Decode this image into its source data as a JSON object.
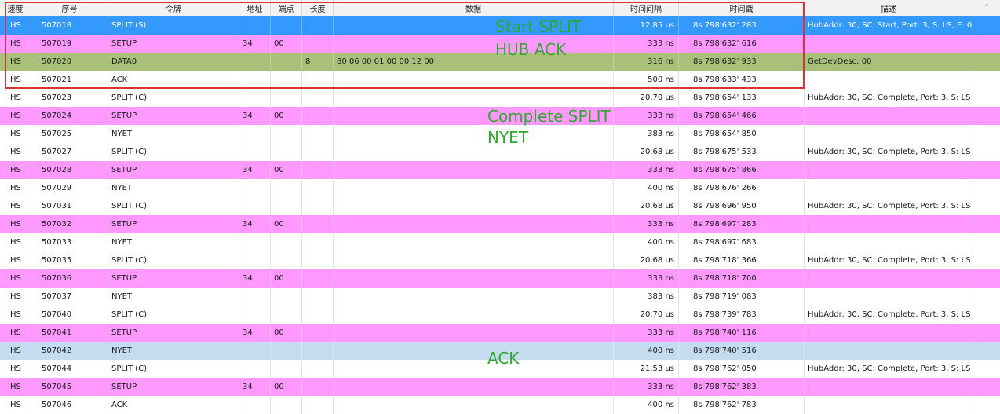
{
  "columns": {
    "speed": "速度",
    "seq": "序号",
    "token": "令牌",
    "addr": "地址",
    "endpoint": "端点",
    "length": "长度",
    "data": "数据",
    "interval": "时间间隔",
    "timestamp": "时间戳",
    "desc": "描述",
    "extra": "⌃"
  },
  "row_colors": {
    "setup": "#ff99ff",
    "selected": "#3399ff",
    "data0": "#a9c07a",
    "highlight": "#c5dcf0"
  },
  "rows": [
    {
      "style": "sel",
      "speed": "HS",
      "seq": "507018",
      "token": "SPLIT (S)",
      "addr": "",
      "endpoint": "",
      "length": "",
      "data": "",
      "interval": "12.85 us",
      "timestamp": "8s 798'632' 283",
      "desc": "HubAddr: 30, SC: Start, Port: 3, S: LS, E: 0"
    },
    {
      "style": "setup",
      "speed": "HS",
      "seq": "507019",
      "token": "SETUP",
      "addr": "34",
      "endpoint": "00",
      "length": "",
      "data": "",
      "interval": "333 ns",
      "timestamp": "8s 798'632' 616",
      "desc": ""
    },
    {
      "style": "data0",
      "speed": "HS",
      "seq": "507020",
      "token": "DATA0",
      "addr": "",
      "endpoint": "",
      "length": "8",
      "data": "80 06 00 01 00 00 12 00",
      "interval": "316 ns",
      "timestamp": "8s 798'632' 933",
      "desc": " GetDevDesc: 00"
    },
    {
      "style": "",
      "speed": "HS",
      "seq": "507021",
      "token": "ACK",
      "addr": "",
      "endpoint": "",
      "length": "",
      "data": "",
      "interval": "500 ns",
      "timestamp": "8s 798'633' 433",
      "desc": ""
    },
    {
      "style": "",
      "speed": "HS",
      "seq": "507023",
      "token": "SPLIT (C)",
      "addr": "",
      "endpoint": "",
      "length": "",
      "data": "",
      "interval": "20.70 us",
      "timestamp": "8s 798'654' 133",
      "desc": "HubAddr: 30, SC: Complete, Port: 3, S: LS"
    },
    {
      "style": "setup",
      "speed": "HS",
      "seq": "507024",
      "token": "SETUP",
      "addr": "34",
      "endpoint": "00",
      "length": "",
      "data": "",
      "interval": "333 ns",
      "timestamp": "8s 798'654' 466",
      "desc": ""
    },
    {
      "style": "",
      "speed": "HS",
      "seq": "507025",
      "token": "NYET",
      "addr": "",
      "endpoint": "",
      "length": "",
      "data": "",
      "interval": "383 ns",
      "timestamp": "8s 798'654' 850",
      "desc": ""
    },
    {
      "style": "",
      "speed": "HS",
      "seq": "507027",
      "token": "SPLIT (C)",
      "addr": "",
      "endpoint": "",
      "length": "",
      "data": "",
      "interval": "20.68 us",
      "timestamp": "8s 798'675' 533",
      "desc": "HubAddr: 30, SC: Complete, Port: 3, S: LS"
    },
    {
      "style": "setup",
      "speed": "HS",
      "seq": "507028",
      "token": "SETUP",
      "addr": "34",
      "endpoint": "00",
      "length": "",
      "data": "",
      "interval": "333 ns",
      "timestamp": "8s 798'675' 866",
      "desc": ""
    },
    {
      "style": "",
      "speed": "HS",
      "seq": "507029",
      "token": "NYET",
      "addr": "",
      "endpoint": "",
      "length": "",
      "data": "",
      "interval": "400 ns",
      "timestamp": "8s 798'676' 266",
      "desc": ""
    },
    {
      "style": "",
      "speed": "HS",
      "seq": "507031",
      "token": "SPLIT (C)",
      "addr": "",
      "endpoint": "",
      "length": "",
      "data": "",
      "interval": "20.68 us",
      "timestamp": "8s 798'696' 950",
      "desc": "HubAddr: 30, SC: Complete, Port: 3, S: LS"
    },
    {
      "style": "setup",
      "speed": "HS",
      "seq": "507032",
      "token": "SETUP",
      "addr": "34",
      "endpoint": "00",
      "length": "",
      "data": "",
      "interval": "333 ns",
      "timestamp": "8s 798'697' 283",
      "desc": ""
    },
    {
      "style": "",
      "speed": "HS",
      "seq": "507033",
      "token": "NYET",
      "addr": "",
      "endpoint": "",
      "length": "",
      "data": "",
      "interval": "400 ns",
      "timestamp": "8s 798'697' 683",
      "desc": ""
    },
    {
      "style": "",
      "speed": "HS",
      "seq": "507035",
      "token": "SPLIT (C)",
      "addr": "",
      "endpoint": "",
      "length": "",
      "data": "",
      "interval": "20.68 us",
      "timestamp": "8s 798'718' 366",
      "desc": "HubAddr: 30, SC: Complete, Port: 3, S: LS"
    },
    {
      "style": "setup",
      "speed": "HS",
      "seq": "507036",
      "token": "SETUP",
      "addr": "34",
      "endpoint": "00",
      "length": "",
      "data": "",
      "interval": "333 ns",
      "timestamp": "8s 798'718' 700",
      "desc": ""
    },
    {
      "style": "",
      "speed": "HS",
      "seq": "507037",
      "token": "NYET",
      "addr": "",
      "endpoint": "",
      "length": "",
      "data": "",
      "interval": "383 ns",
      "timestamp": "8s 798'719' 083",
      "desc": ""
    },
    {
      "style": "",
      "speed": "HS",
      "seq": "507040",
      "token": "SPLIT (C)",
      "addr": "",
      "endpoint": "",
      "length": "",
      "data": "",
      "interval": "20.70 us",
      "timestamp": "8s 798'739' 783",
      "desc": "HubAddr: 30, SC: Complete, Port: 3, S: LS"
    },
    {
      "style": "setup",
      "speed": "HS",
      "seq": "507041",
      "token": "SETUP",
      "addr": "34",
      "endpoint": "00",
      "length": "",
      "data": "",
      "interval": "333 ns",
      "timestamp": "8s 798'740' 116",
      "desc": ""
    },
    {
      "style": "hl",
      "speed": "HS",
      "seq": "507042",
      "token": "NYET",
      "addr": "",
      "endpoint": "",
      "length": "",
      "data": "",
      "interval": "400 ns",
      "timestamp": "8s 798'740' 516",
      "desc": ""
    },
    {
      "style": "",
      "speed": "HS",
      "seq": "507044",
      "token": "SPLIT (C)",
      "addr": "",
      "endpoint": "",
      "length": "",
      "data": "",
      "interval": "21.53 us",
      "timestamp": "8s 798'762' 050",
      "desc": "HubAddr: 30, SC: Complete, Port: 3, S: LS"
    },
    {
      "style": "setup",
      "speed": "HS",
      "seq": "507045",
      "token": "SETUP",
      "addr": "34",
      "endpoint": "00",
      "length": "",
      "data": "",
      "interval": "333 ns",
      "timestamp": "8s 798'762' 383",
      "desc": ""
    },
    {
      "style": "",
      "speed": "HS",
      "seq": "507046",
      "token": "ACK",
      "addr": "",
      "endpoint": "",
      "length": "",
      "data": "",
      "interval": "400 ns",
      "timestamp": "8s 798'762' 783",
      "desc": ""
    }
  ],
  "annotations": {
    "start_split": "Start SPLIT",
    "hub_ack": "HUB ACK",
    "complete_split": "Complete SPLIT",
    "nyet": "NYET",
    "ack": "ACK",
    "color": "#2ea82e",
    "frame_color": "#e03030"
  }
}
